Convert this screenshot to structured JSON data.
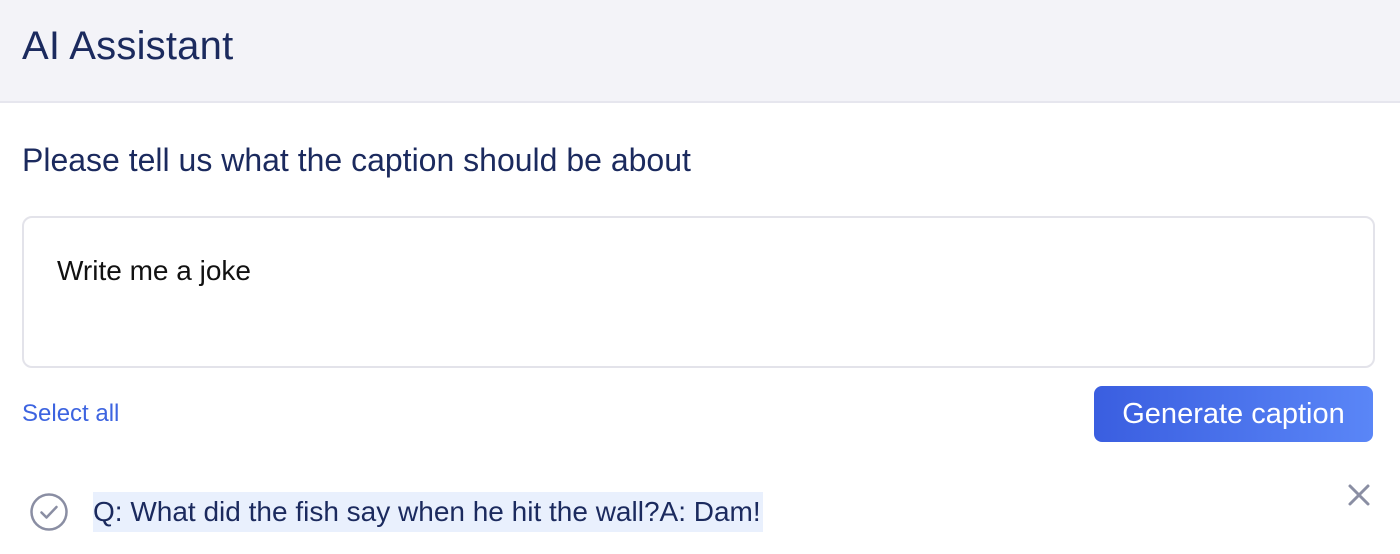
{
  "header": {
    "title": "AI Assistant"
  },
  "prompt": {
    "label": "Please tell us what the caption should be about",
    "value": "Write me a joke"
  },
  "actions": {
    "select_all_label": "Select all",
    "generate_label": "Generate caption"
  },
  "results": [
    {
      "text": "Q: What did the fish say when he hit the wall?A: Dam!",
      "check_icon": "check-circle-icon",
      "close_icon": "close-icon"
    }
  ],
  "colors": {
    "header_bg": "#f3f3f8",
    "primary_text": "#1b2a5e",
    "link": "#3d64e0",
    "button_gradient_start": "#3a5ee0",
    "button_gradient_end": "#5a86f7",
    "highlight": "#e9f0fd"
  }
}
